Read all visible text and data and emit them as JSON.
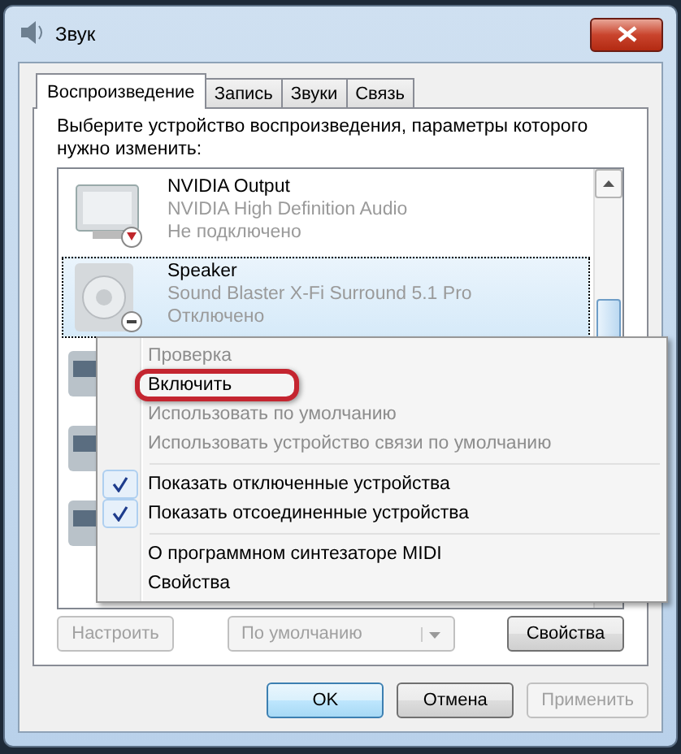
{
  "window": {
    "title": "Звук"
  },
  "tabs": [
    {
      "label": "Воспроизведение",
      "selected": true
    },
    {
      "label": "Запись",
      "selected": false
    },
    {
      "label": "Звуки",
      "selected": false
    },
    {
      "label": "Связь",
      "selected": false
    }
  ],
  "instruction": "Выберите устройство воспроизведения, параметры которого нужно изменить:",
  "devices": [
    {
      "kind": "monitor",
      "name": "NVIDIA Output",
      "description": "NVIDIA High Definition Audio",
      "status": "Не подключено",
      "selected": false
    },
    {
      "kind": "speaker",
      "name": "Speaker",
      "description": "Sound Blaster X-Fi Surround 5.1 Pro",
      "status": "Отключено",
      "selected": true
    }
  ],
  "context_menu": [
    {
      "kind": "item",
      "label": "Проверка",
      "disabled": true,
      "checked": false,
      "highlighted": false
    },
    {
      "kind": "item",
      "label": "Включить",
      "disabled": false,
      "checked": false,
      "highlighted": true
    },
    {
      "kind": "item",
      "label": "Использовать по умолчанию",
      "disabled": true,
      "checked": false,
      "highlighted": false
    },
    {
      "kind": "item",
      "label": "Использовать устройство связи по умолчанию",
      "disabled": true,
      "checked": false,
      "highlighted": false
    },
    {
      "kind": "separator"
    },
    {
      "kind": "item",
      "label": "Показать отключенные устройства",
      "disabled": false,
      "checked": true,
      "highlighted": false
    },
    {
      "kind": "item",
      "label": "Показать отсоединенные устройства",
      "disabled": false,
      "checked": true,
      "highlighted": false
    },
    {
      "kind": "separator"
    },
    {
      "kind": "item",
      "label": "О программном синтезаторе MIDI",
      "disabled": false,
      "checked": false,
      "highlighted": false
    },
    {
      "kind": "item",
      "label": "Свойства",
      "disabled": false,
      "checked": false,
      "highlighted": false
    }
  ],
  "panel_buttons": [
    {
      "kind": "button",
      "label": "Настроить",
      "disabled": true
    },
    {
      "kind": "dropdown",
      "label": "По умолчанию",
      "disabled": true
    },
    {
      "kind": "button",
      "label": "Свойства",
      "disabled": false
    }
  ],
  "dialog_buttons": [
    {
      "label": "OK",
      "disabled": false,
      "default": true
    },
    {
      "label": "Отмена",
      "disabled": false,
      "default": false
    },
    {
      "label": "Применить",
      "disabled": true,
      "default": false
    }
  ]
}
